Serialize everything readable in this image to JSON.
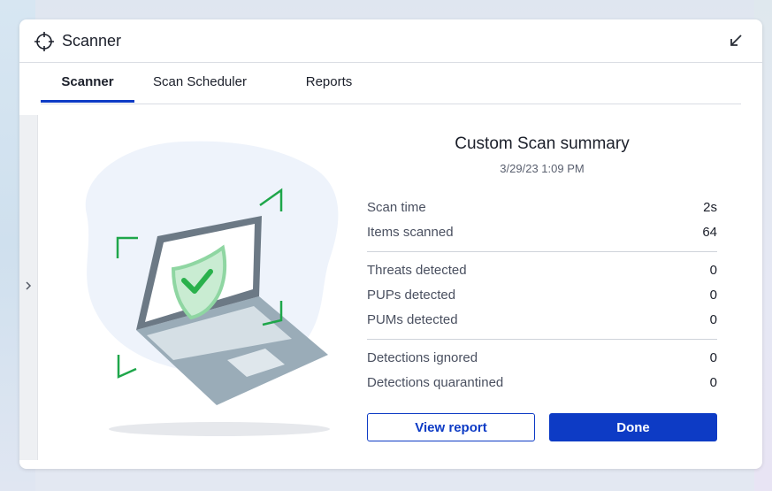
{
  "window": {
    "title": "Scanner",
    "icon": "crosshair-icon",
    "minimize_icon": "minimize-arrow-icon"
  },
  "tabs": [
    {
      "label": "Scanner",
      "active": true
    },
    {
      "label": "Scan Scheduler",
      "active": false
    },
    {
      "label": "Reports",
      "active": false
    }
  ],
  "side_panel": {
    "icon": "chevron-right-icon"
  },
  "illustration": {
    "icon": "laptop-shield-check-icon"
  },
  "summary": {
    "title": "Custom Scan summary",
    "date": "3/29/23 1:09 PM",
    "groups": [
      [
        {
          "label": "Scan time",
          "value": "2s"
        },
        {
          "label": "Items scanned",
          "value": "64"
        }
      ],
      [
        {
          "label": "Threats detected",
          "value": "0"
        },
        {
          "label": "PUPs detected",
          "value": "0"
        },
        {
          "label": "PUMs detected",
          "value": "0"
        }
      ],
      [
        {
          "label": "Detections ignored",
          "value": "0"
        },
        {
          "label": "Detections quarantined",
          "value": "0"
        }
      ]
    ]
  },
  "buttons": {
    "view_report": "View report",
    "done": "Done"
  },
  "colors": {
    "accent": "#0d3bc5",
    "shield_green": "#2ab14c",
    "bracket_green": "#1ea64a"
  }
}
